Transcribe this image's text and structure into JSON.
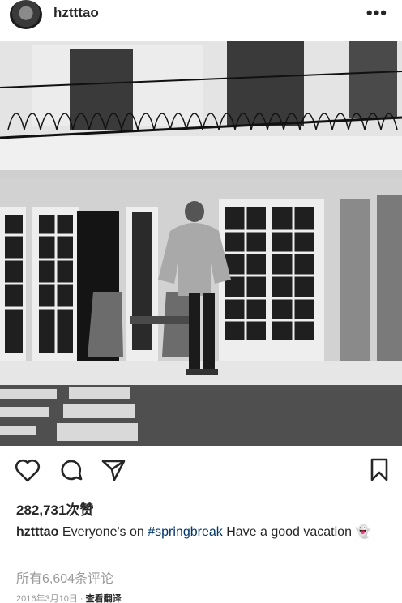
{
  "post": {
    "username": "hztttao",
    "more_icon": "more-horizontal-icon",
    "likes": "282,731次赞",
    "caption": {
      "username": "hztttao",
      "text_before": "Everyone's on",
      "hashtag": "#springbreak",
      "text_after": "Have a good vacation",
      "emoji": "👻"
    },
    "comments_link": "所有6,604条评论",
    "date": "2016年3月10日",
    "separator": "·",
    "translate_label": "查看翻译"
  },
  "actions": [
    "heart-icon",
    "comment-icon",
    "share-icon",
    "bookmark-icon"
  ],
  "colors": {
    "text": "#262626",
    "secondary": "#999999",
    "hashtag": "#003569"
  }
}
